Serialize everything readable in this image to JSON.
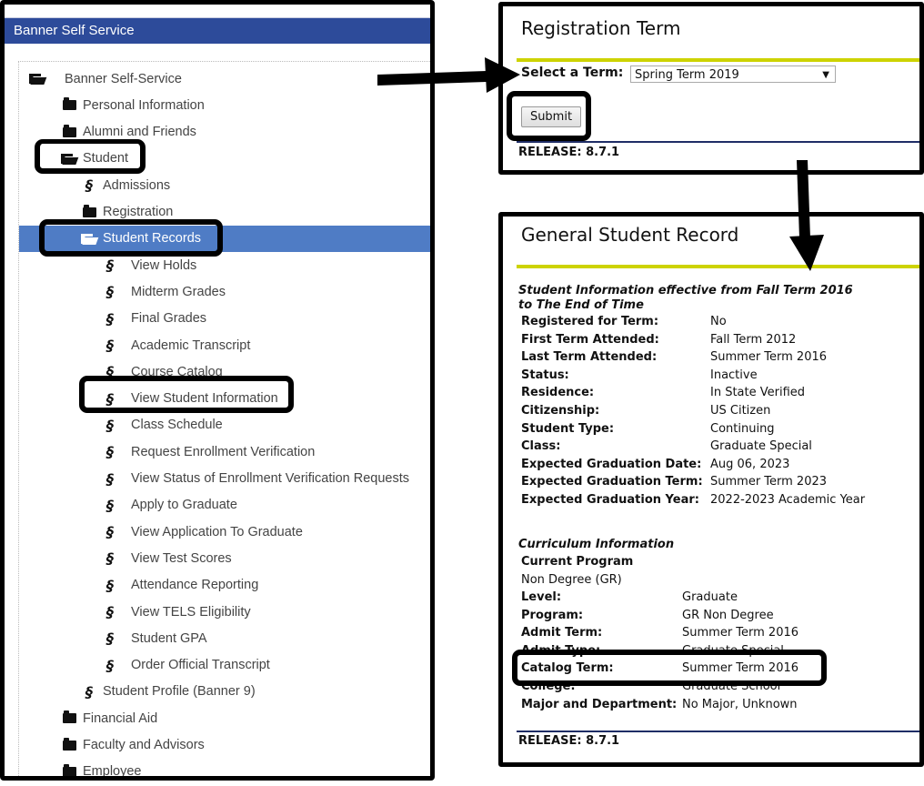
{
  "left": {
    "header_title": "Banner Self Service",
    "tree": [
      {
        "label": "Banner Self-Service",
        "icon": "folder-open-icon",
        "level": 0
      },
      {
        "label": "Personal Information",
        "icon": "folder-icon",
        "level": 1
      },
      {
        "label": "Alumni and Friends",
        "icon": "folder-icon",
        "level": 1
      },
      {
        "label": "Student",
        "icon": "folder-open-icon",
        "level": 1
      },
      {
        "label": "Admissions",
        "icon": "link-icon",
        "level": 2
      },
      {
        "label": "Registration",
        "icon": "folder-icon",
        "level": 2
      },
      {
        "label": "Student Records",
        "icon": "folder-open-icon",
        "level": 2,
        "selected": true
      },
      {
        "label": "View Holds",
        "icon": "link-icon",
        "level": 3
      },
      {
        "label": "Midterm Grades",
        "icon": "link-icon",
        "level": 3
      },
      {
        "label": "Final Grades",
        "icon": "link-icon",
        "level": 3
      },
      {
        "label": "Academic Transcript",
        "icon": "link-icon",
        "level": 3
      },
      {
        "label": "Course Catalog",
        "icon": "link-icon",
        "level": 3
      },
      {
        "label": "View Student Information",
        "icon": "link-icon",
        "level": 3
      },
      {
        "label": "Class Schedule",
        "icon": "link-icon",
        "level": 3
      },
      {
        "label": "Request Enrollment Verification",
        "icon": "link-icon",
        "level": 3
      },
      {
        "label": "View Status of Enrollment Verification Requests",
        "icon": "link-icon",
        "level": 3
      },
      {
        "label": "Apply to Graduate",
        "icon": "link-icon",
        "level": 3
      },
      {
        "label": "View Application To Graduate",
        "icon": "link-icon",
        "level": 3
      },
      {
        "label": "View Test Scores",
        "icon": "link-icon",
        "level": 3
      },
      {
        "label": "Attendance Reporting",
        "icon": "link-icon",
        "level": 3
      },
      {
        "label": "View TELS Eligibility",
        "icon": "link-icon",
        "level": 3
      },
      {
        "label": "Student GPA",
        "icon": "link-icon",
        "level": 3
      },
      {
        "label": "Order Official Transcript",
        "icon": "link-icon",
        "level": 3
      },
      {
        "label": "Student Profile (Banner 9)",
        "icon": "link-icon",
        "level": 2
      },
      {
        "label": "Financial Aid",
        "icon": "folder-icon",
        "level": 1
      },
      {
        "label": "Faculty and Advisors",
        "icon": "folder-icon",
        "level": 1
      },
      {
        "label": "Employee",
        "icon": "folder-icon",
        "level": 1
      }
    ]
  },
  "registration_term": {
    "title": "Registration Term",
    "select_label": "Select a Term:",
    "selected_term": "Spring Term 2019",
    "submit_label": "Submit",
    "release": "RELEASE: 8.7.1"
  },
  "student_record": {
    "title": "General Student Record",
    "section1_heading_line1": "Student Information effective from Fall Term 2016",
    "section1_heading_line2": "to The End of Time",
    "section1_rows": [
      {
        "label": "Registered for Term:",
        "value": "No"
      },
      {
        "label": "First Term Attended:",
        "value": "Fall Term 2012"
      },
      {
        "label": "Last Term Attended:",
        "value": "Summer Term 2016"
      },
      {
        "label": "Status:",
        "value": "Inactive"
      },
      {
        "label": "Residence:",
        "value": "In State Verified"
      },
      {
        "label": "Citizenship:",
        "value": "US Citizen"
      },
      {
        "label": "Student Type:",
        "value": "Continuing"
      },
      {
        "label": "Class:",
        "value": "Graduate Special"
      },
      {
        "label": "Expected Graduation Date:",
        "value": "Aug 06, 2023"
      },
      {
        "label": "Expected Graduation Term:",
        "value": "Summer Term 2023"
      },
      {
        "label": "Expected Graduation Year:",
        "value": "2022-2023 Academic Year"
      }
    ],
    "section2_heading": "Curriculum Information",
    "current_program_label": "Current Program",
    "current_program_value": "Non Degree (GR)",
    "section2_rows": [
      {
        "label": "Level:",
        "value": "Graduate"
      },
      {
        "label": "Program:",
        "value": "GR Non Degree"
      },
      {
        "label": "Admit Term:",
        "value": "Summer Term 2016"
      },
      {
        "label": "Admit Type:",
        "value": "Graduate Special"
      },
      {
        "label": "Catalog Term:",
        "value": "Summer Term 2016"
      },
      {
        "label": "College:",
        "value": "Graduate School"
      },
      {
        "label": "Major and Department:",
        "value": "No Major, Unknown"
      }
    ],
    "release": "RELEASE: 8.7.1"
  },
  "colors": {
    "header_blue": "#2d4b9a",
    "selected_blue": "#4f7cc5",
    "lime_rule": "#cdd300",
    "navy_rule": "#1f2d66"
  }
}
